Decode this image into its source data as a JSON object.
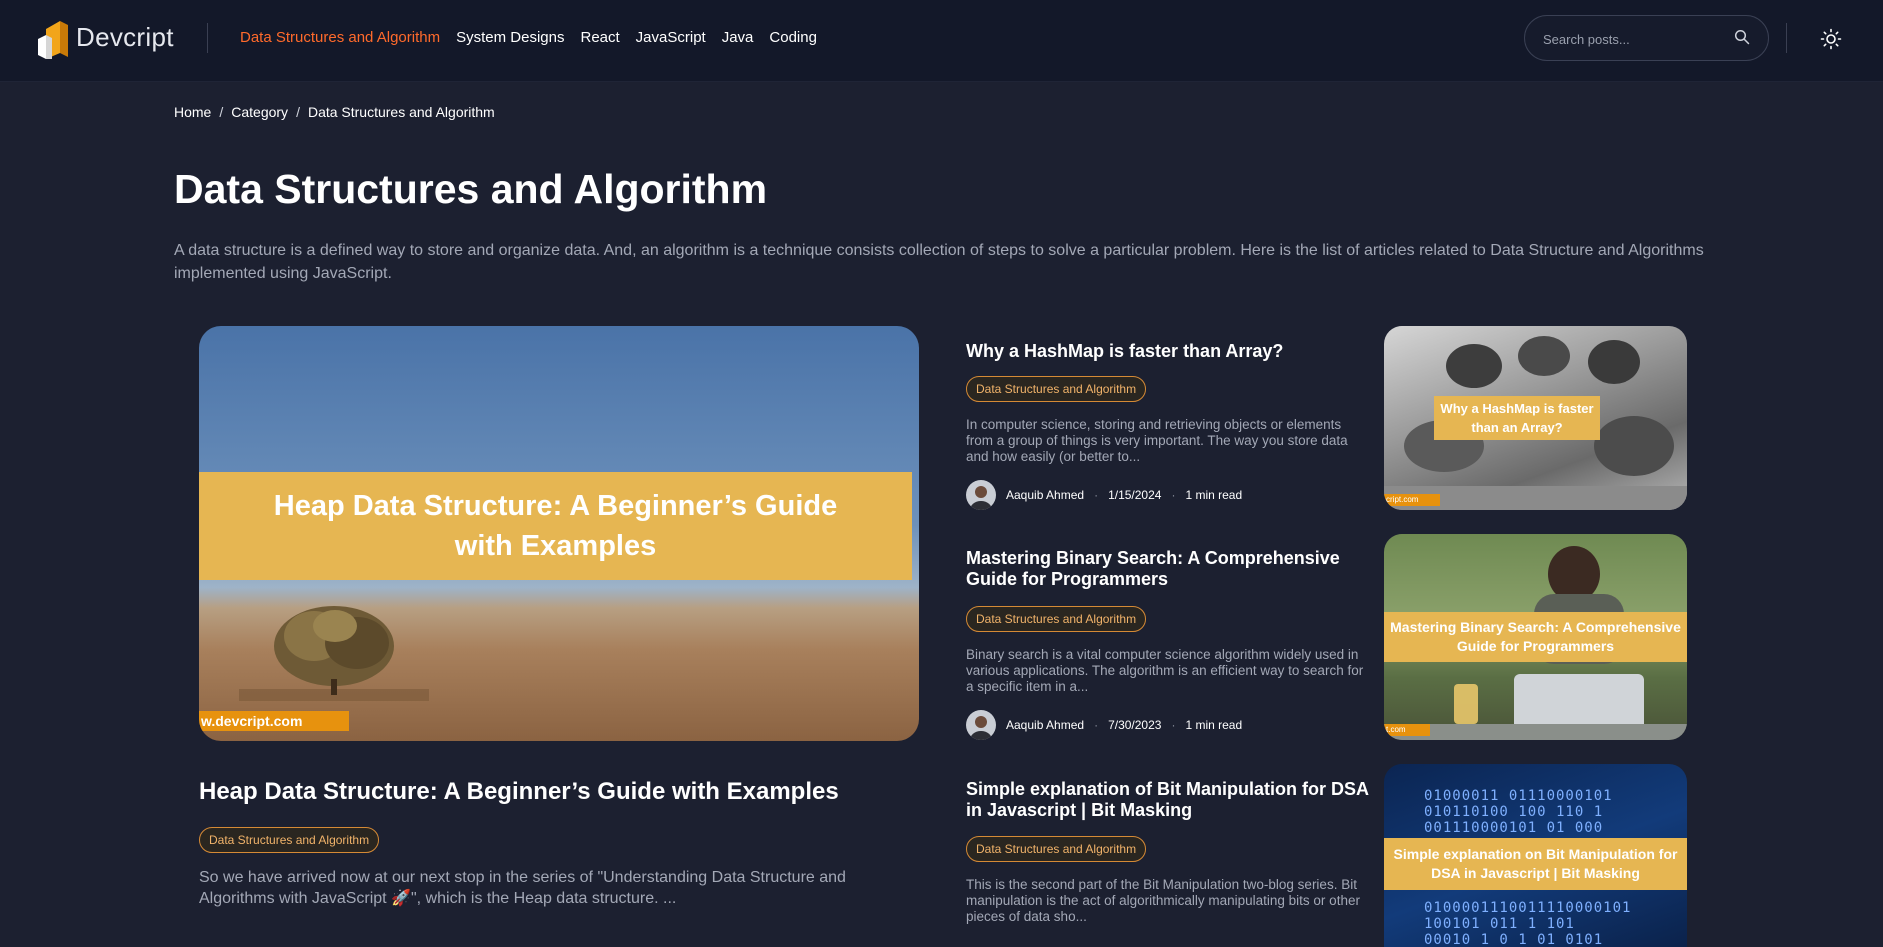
{
  "header": {
    "logo_text": "Devcript",
    "nav": [
      {
        "label": "Data Structures and Algorithm",
        "active": true
      },
      {
        "label": "System Designs"
      },
      {
        "label": "React"
      },
      {
        "label": "JavaScript"
      },
      {
        "label": "Java"
      },
      {
        "label": "Coding"
      }
    ],
    "search_placeholder": "Search posts..."
  },
  "breadcrumb": {
    "items": [
      "Home",
      "Category",
      "Data Structures and Algorithm"
    ],
    "separator": "/"
  },
  "page": {
    "title": "Data Structures and Algorithm",
    "description": "A data structure is a defined way to store and organize data. And, an algorithm is a technique consists collection of steps to solve a particular problem. Here is the list of articles related to Data Structure and Algorithms implemented using JavaScript."
  },
  "featured": {
    "image_caption": "Heap Data Structure: A Beginner’s Guide with Examples",
    "image_tag": "w.devcript.com",
    "title": "Heap Data Structure: A Beginner’s Guide with Examples",
    "category": "Data Structures and Algorithm",
    "excerpt": "So we have arrived now at our next stop in the series of \"Understanding Data Structure and Algorithms with JavaScript 🚀\", which is the Heap data structure. ..."
  },
  "posts": [
    {
      "title": "Why a HashMap is faster than Array?",
      "category": "Data Structures and Algorithm",
      "excerpt": "In computer science, storing and retrieving objects or elements from a group of things is very important. The way you store data and how easily (or better to...",
      "author": "Aaquib Ahmed",
      "date": "1/15/2024",
      "read_time": "1 min read",
      "image_caption": "Why a HashMap is faster than an Array?",
      "image_tag": "cript.com"
    },
    {
      "title": "Mastering Binary Search: A Comprehensive Guide for Programmers",
      "category": "Data Structures and Algorithm",
      "excerpt": "Binary search is a vital computer science algorithm widely used in various applications. The algorithm is an efficient way to search for a specific item in a...",
      "author": "Aaquib Ahmed",
      "date": "7/30/2023",
      "read_time": "1 min read",
      "image_caption": "Mastering Binary Search: A Comprehensive Guide for Programmers",
      "image_tag": "t.com"
    },
    {
      "title": "Simple explanation of Bit Manipulation for DSA in Javascript | Bit Masking",
      "category": "Data Structures and Algorithm",
      "excerpt": "This is the second part of the Bit Manipulation two-blog series. Bit manipulation is the act of algorithmically manipulating bits or other pieces of data sho...",
      "image_caption": "Simple explanation on Bit Manipulation for DSA in Javascript | Bit Masking",
      "binary_rows": [
        "01000011  01110000101",
        "010110100  100    110  1",
        "001110000101    01  000",
        "0100001110011110000101",
        "100101      011    1  101",
        "00010  1  0  1  01  0101"
      ]
    }
  ],
  "colors": {
    "accent": "#ff6a2b",
    "background": "#1c2030",
    "header_bg": "#131829",
    "pill_border": "#d58a35",
    "band_yellow": "#e6b652"
  },
  "icons": [
    "logo-icon",
    "search-icon",
    "sun-icon",
    "avatar"
  ]
}
